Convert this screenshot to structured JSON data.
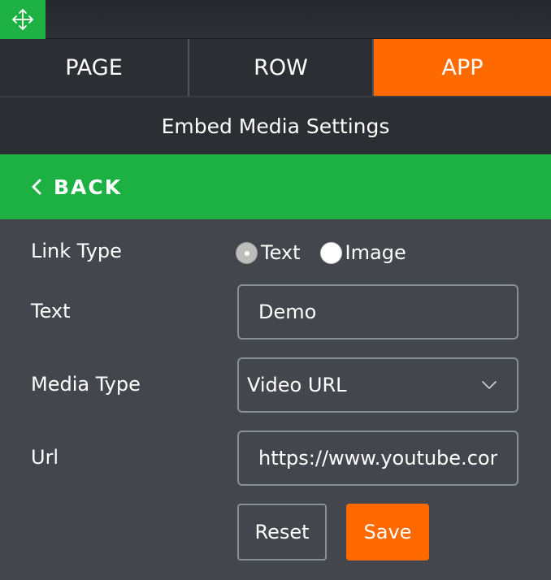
{
  "tabs": {
    "page": "PAGE",
    "row": "ROW",
    "app": "APP"
  },
  "title": "Embed Media Settings",
  "back_label": "BACK",
  "form": {
    "link_type": {
      "label": "Link Type",
      "options": [
        "Text",
        "Image"
      ],
      "selected": "Text"
    },
    "text": {
      "label": "Text",
      "value": "Demo"
    },
    "media_type": {
      "label": "Media Type",
      "selected": "Video URL"
    },
    "url": {
      "label": "Url",
      "value": "https://www.youtube.com/watch"
    }
  },
  "buttons": {
    "reset": "Reset",
    "save": "Save"
  },
  "icons": {
    "drag": "move-arrows-icon",
    "back": "chevron-left-icon",
    "select": "chevron-down-icon"
  },
  "colors": {
    "accent_orange": "#ff6a00",
    "accent_green": "#1db043",
    "panel_bg": "#43474d",
    "dark_bg": "#2b2e32"
  }
}
